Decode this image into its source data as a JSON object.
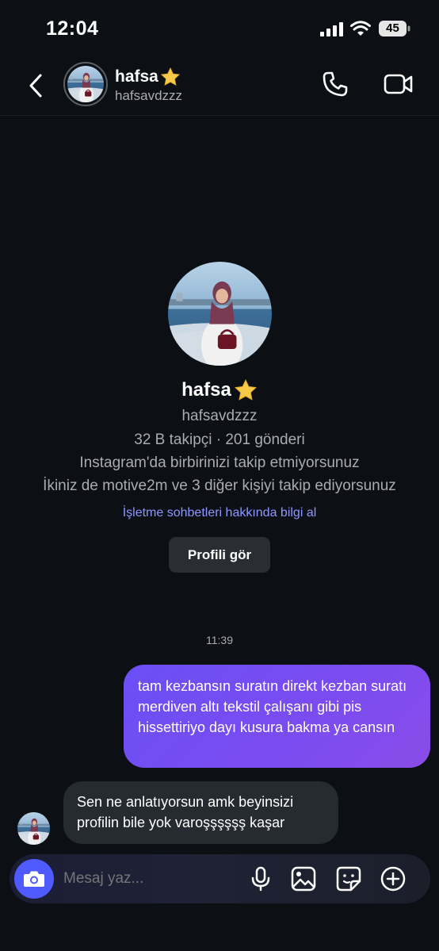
{
  "status_bar": {
    "time": "12:04",
    "battery": "45"
  },
  "header": {
    "name": "hafsa",
    "username": "hafsavdzzz"
  },
  "profile": {
    "name": "hafsa",
    "username": "hafsavdzzz",
    "stats": "32 B takipçi · 201 gönderi",
    "follow_status": "Instagram'da birbirinizi takip etmiyorsunuz",
    "mutual": "İkiniz de motive2m ve 3 diğer kişiyi takip ediyorsunuz",
    "business_link": "İşletme sohbetleri hakkında bilgi al",
    "view_profile": "Profili gör"
  },
  "conversation": {
    "timestamp": "11:39",
    "messages": [
      {
        "direction": "outgoing",
        "text": "tam kezbansın suratın direkt kezban suratı merdiven altı tekstil çalışanı gibi pis hissettiriyo dayı kusura bakma ya cansın"
      },
      {
        "direction": "incoming",
        "text": "Sen ne anlatıyorsun amk beyinsizi profilin bile yok varoşşşşşş kaşar"
      }
    ]
  },
  "composer": {
    "placeholder": "Mesaj yaz..."
  },
  "colors": {
    "background": "#0c0f14",
    "outgoing_bubble": "#6a4ff6",
    "incoming_bubble": "#262a31",
    "link": "#8e97ff",
    "camera_button": "#4f5bff"
  },
  "icons": {
    "back": "chevron-left-icon",
    "call": "phone-icon",
    "video": "video-camera-icon",
    "star": "star-icon",
    "camera": "camera-icon",
    "mic": "microphone-icon",
    "gallery": "image-icon",
    "sticker": "sticker-icon",
    "plus": "plus-circle-icon"
  }
}
